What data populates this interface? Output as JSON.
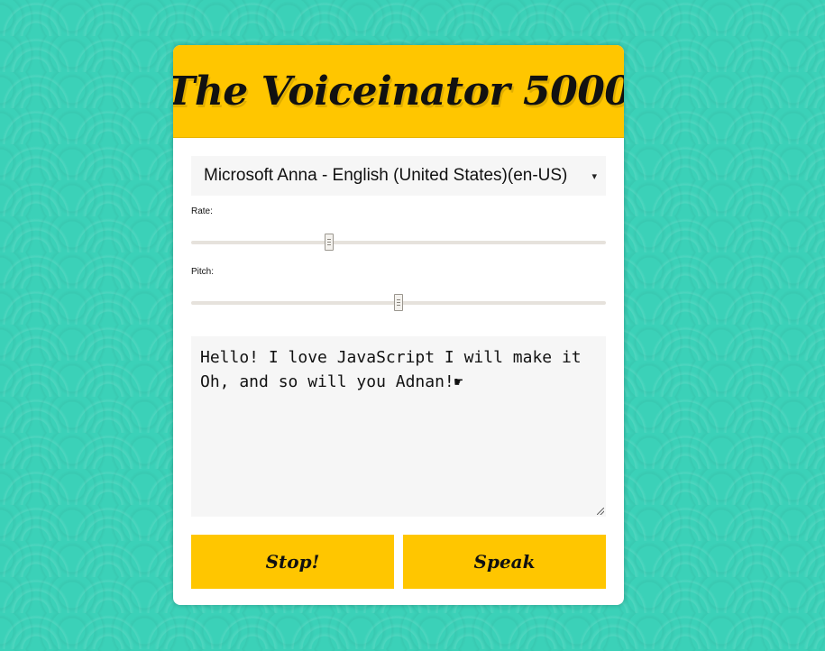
{
  "app": {
    "title": "The Voiceinator 5000"
  },
  "voice": {
    "selected": "Microsoft Anna - English (United States)(en-US)"
  },
  "rate": {
    "label": "Rate:",
    "value": 1,
    "min": 0,
    "max": 3
  },
  "pitch": {
    "label": "Pitch:",
    "value": 1,
    "min": 0,
    "max": 2
  },
  "message": {
    "line1": "Hello! I love JavaScript I will make it",
    "line2": "Oh, and so will you Adnan!"
  },
  "buttons": {
    "stop_label": "Stop!",
    "speak_label": "Speak"
  },
  "colors": {
    "background": "#3bd1b8",
    "accent": "#ffc600",
    "field": "#f6f6f6"
  },
  "icons": {
    "select_caret": "▾",
    "pointer": "☛"
  }
}
